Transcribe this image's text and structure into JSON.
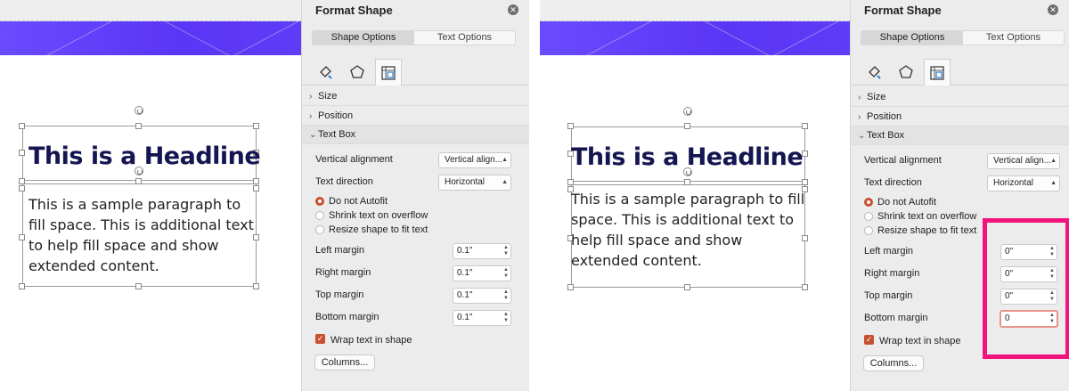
{
  "slide": {
    "headline": "This is a Headline",
    "left_paragraph_lines": [
      "This is a sample paragraph to",
      "fill space. This is additional text",
      "to help fill space and show",
      "extended content."
    ],
    "right_paragraph_lines": [
      "This is a sample paragraph to fill",
      "space. This is additional text to",
      "help fill space and show",
      "extended content."
    ]
  },
  "panel": {
    "title": "Format Shape",
    "close_icon": "close-icon",
    "tabs": {
      "shape_options": "Shape Options",
      "text_options": "Text Options"
    },
    "icon_tabs": [
      "fill-line-icon",
      "effects-pentagon-icon",
      "size-properties-icon"
    ],
    "sections": {
      "size": "Size",
      "position": "Position",
      "text_box": "Text Box"
    },
    "vertical_alignment": {
      "label": "Vertical alignment",
      "value": "Vertical align..."
    },
    "text_direction": {
      "label": "Text direction",
      "value": "Horizontal"
    },
    "autofit": {
      "do_not": "Do not Autofit",
      "shrink": "Shrink text on overflow",
      "resize": "Resize shape to fit text"
    },
    "margins_labels": {
      "left": "Left margin",
      "right": "Right margin",
      "top": "Top margin",
      "bottom": "Bottom margin"
    },
    "wrap": "Wrap text in shape",
    "columns": "Columns..."
  },
  "left_margins": {
    "left": "0.1\"",
    "right": "0.1\"",
    "top": "0.1\"",
    "bottom": "0.1\""
  },
  "right_margins": {
    "left": "0\"",
    "right": "0\"",
    "top": "0\"",
    "bottom": "0"
  },
  "colors": {
    "banner": "#5a35f5",
    "headline": "#151551",
    "accent": "#c6502f",
    "highlight": "#f0147c"
  }
}
